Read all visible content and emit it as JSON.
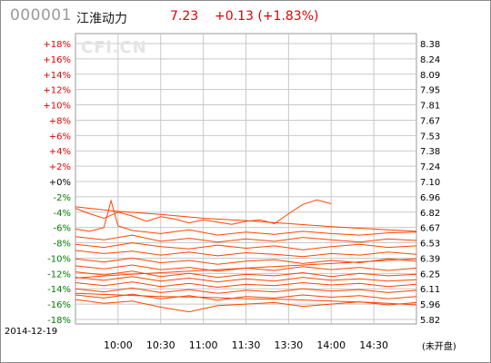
{
  "header": {
    "code": "000001",
    "name": "江淮动力",
    "price": "7.23",
    "change": "+0.13 (+1.83%)"
  },
  "watermark": "CFi.CN",
  "date": "2014-12-19",
  "market_status": "(未开盘)",
  "colors": {
    "up": "#e00000",
    "flat": "#000000",
    "down": "#007a00",
    "series": "#ff4500",
    "grid": "#c8c8c8"
  },
  "chart_data": {
    "type": "line",
    "y_left_ticks": [
      "+18%",
      "+16%",
      "+14%",
      "+12%",
      "+10%",
      "+8%",
      "+6%",
      "+4%",
      "+2%",
      "+0%",
      "-2%",
      "-4%",
      "-6%",
      "-8%",
      "-10%",
      "-12%",
      "-14%",
      "-16%",
      "-18%"
    ],
    "y_left_values": [
      18,
      16,
      14,
      12,
      10,
      8,
      6,
      4,
      2,
      0,
      -2,
      -4,
      -6,
      -8,
      -10,
      -12,
      -14,
      -16,
      -18
    ],
    "y_right_ticks": [
      "8.38",
      "8.24",
      "8.09",
      "7.95",
      "7.81",
      "7.67",
      "7.53",
      "7.38",
      "7.24",
      "7.10",
      "6.96",
      "6.82",
      "6.67",
      "6.53",
      "6.39",
      "6.25",
      "6.11",
      "5.96",
      "5.82"
    ],
    "x_ticks": [
      "10:00",
      "10:30",
      "11:00",
      "11:30",
      "13:30",
      "14:00",
      "14:30"
    ],
    "x_tick_minutes": [
      30,
      60,
      90,
      120,
      150,
      180,
      210
    ],
    "xlim": [
      0,
      240
    ],
    "ylim": [
      -18,
      18
    ],
    "series": [
      {
        "x": [
          0,
          10,
          20,
          30,
          40,
          50,
          60,
          70,
          80,
          90,
          100,
          110,
          120,
          130,
          140,
          150,
          160,
          170,
          180,
          190,
          200,
          210,
          220,
          230,
          240
        ],
        "y": [
          -3.5,
          -4.2,
          -4.8,
          -4.0,
          -4.5,
          -5.2,
          -4.6,
          -4.9,
          -5.4,
          -5.0,
          -5.3,
          -5.6,
          -5.2,
          -5.0,
          -5.5,
          -4.2,
          -3.0,
          -2.4,
          -2.9,
          null,
          null,
          null,
          null,
          null,
          null
        ]
      },
      {
        "x": [
          0,
          30,
          60,
          90,
          120,
          150,
          180,
          210,
          240
        ],
        "y": [
          -3.3,
          -3.9,
          -4.3,
          -4.8,
          -5.1,
          -5.5,
          -5.9,
          -6.2,
          -6.5
        ]
      },
      {
        "x": [
          0,
          10,
          20,
          25,
          30,
          40,
          60,
          80,
          100,
          120,
          140,
          160,
          180,
          200,
          220,
          240
        ],
        "y": [
          -6.2,
          -6.5,
          -6.0,
          -2.5,
          -5.8,
          -6.4,
          -6.8,
          -6.3,
          -7.0,
          -6.6,
          -6.9,
          -6.5,
          -6.8,
          -7.0,
          -6.7,
          -6.6
        ]
      },
      {
        "x": [
          0,
          20,
          40,
          60,
          80,
          100,
          120,
          140,
          160,
          180,
          200,
          220,
          240
        ],
        "y": [
          -7.2,
          -7.6,
          -7.0,
          -7.8,
          -7.4,
          -7.9,
          -7.5,
          -7.8,
          -7.3,
          -7.6,
          -7.9,
          -7.5,
          -7.7
        ]
      },
      {
        "x": [
          0,
          20,
          40,
          60,
          80,
          100,
          120,
          140,
          160,
          180,
          200,
          220,
          240
        ],
        "y": [
          -8.2,
          -8.6,
          -8.0,
          -8.5,
          -8.8,
          -8.3,
          -8.7,
          -8.4,
          -8.9,
          -8.5,
          -8.2,
          -8.6,
          -8.4
        ]
      },
      {
        "x": [
          0,
          20,
          40,
          60,
          80,
          100,
          120,
          140,
          160,
          180,
          200,
          220,
          240
        ],
        "y": [
          -9.0,
          -9.4,
          -9.1,
          -9.6,
          -9.2,
          -9.7,
          -9.3,
          -9.5,
          -9.8,
          -9.4,
          -9.6,
          -9.2,
          -9.5
        ]
      },
      {
        "x": [
          0,
          20,
          40,
          60,
          80,
          100,
          120,
          140,
          160,
          180,
          200,
          220,
          240
        ],
        "y": [
          -10.1,
          -10.5,
          -10.0,
          -10.6,
          -10.3,
          -10.8,
          -10.4,
          -10.2,
          -10.7,
          -10.3,
          -10.6,
          -10.1,
          -10.4
        ]
      },
      {
        "x": [
          0,
          20,
          40,
          60,
          80,
          100,
          120,
          140,
          160,
          180,
          200,
          220,
          240
        ],
        "y": [
          -11.0,
          -11.4,
          -10.9,
          -11.5,
          -11.2,
          -11.7,
          -11.3,
          -11.6,
          -11.1,
          -11.5,
          -11.2,
          -11.6,
          -11.3
        ]
      },
      {
        "x": [
          0,
          20,
          40,
          60,
          80,
          100,
          120,
          140,
          160,
          180,
          200,
          220,
          240
        ],
        "y": [
          -11.8,
          -12.2,
          -11.7,
          -12.4,
          -12.0,
          -12.5,
          -12.1,
          -12.3,
          -11.9,
          -12.4,
          -12.0,
          -12.3,
          -12.1
        ]
      },
      {
        "x": [
          0,
          20,
          40,
          60,
          80,
          100,
          120,
          140,
          160,
          180,
          200,
          220,
          240
        ],
        "y": [
          -12.5,
          -12.9,
          -12.4,
          -13.0,
          -12.6,
          -13.1,
          -12.7,
          -13.0,
          -12.5,
          -12.9,
          -12.7,
          -13.0,
          -12.8
        ]
      },
      {
        "x": [
          0,
          20,
          40,
          60,
          80,
          100,
          120,
          140,
          160,
          180,
          200,
          220,
          240
        ],
        "y": [
          -13.2,
          -13.6,
          -13.1,
          -13.7,
          -13.3,
          -13.8,
          -13.4,
          -13.6,
          -13.2,
          -13.5,
          -13.3,
          -13.7,
          -13.4
        ]
      },
      {
        "x": [
          0,
          20,
          40,
          60,
          80,
          100,
          120,
          140,
          160,
          180,
          200,
          220,
          240
        ],
        "y": [
          -14.0,
          -14.4,
          -13.9,
          -14.5,
          -14.1,
          -14.6,
          -14.2,
          -14.4,
          -14.0,
          -14.3,
          -14.1,
          -14.5,
          -14.2
        ]
      },
      {
        "x": [
          0,
          20,
          40,
          60,
          80,
          100,
          120,
          140,
          160,
          180,
          200,
          220,
          240
        ],
        "y": [
          -14.8,
          -15.2,
          -14.7,
          -15.3,
          -14.9,
          -15.5,
          -15.0,
          -15.2,
          -14.8,
          -15.1,
          -14.9,
          -15.3,
          -15.0
        ]
      },
      {
        "x": [
          0,
          20,
          40,
          60,
          80,
          100,
          120,
          140,
          160,
          180,
          200,
          220,
          240
        ],
        "y": [
          -15.4,
          -15.9,
          -15.6,
          -16.4,
          -17.0,
          -16.2,
          -16.0,
          -15.8,
          -16.3,
          -16.0,
          -15.7,
          -16.1,
          -15.8
        ]
      },
      {
        "x": [
          0,
          30,
          60,
          90,
          120,
          150,
          180,
          210,
          240
        ],
        "y": [
          -12.6,
          -12.2,
          -11.9,
          -11.6,
          -11.3,
          -11.0,
          -10.7,
          -10.4,
          -10.1
        ]
      },
      {
        "x": [
          0,
          30,
          60,
          90,
          120,
          150,
          180,
          210,
          240
        ],
        "y": [
          -14.6,
          -14.8,
          -15.0,
          -15.1,
          -15.3,
          -15.4,
          -15.6,
          -15.8,
          -16.1
        ]
      }
    ]
  }
}
